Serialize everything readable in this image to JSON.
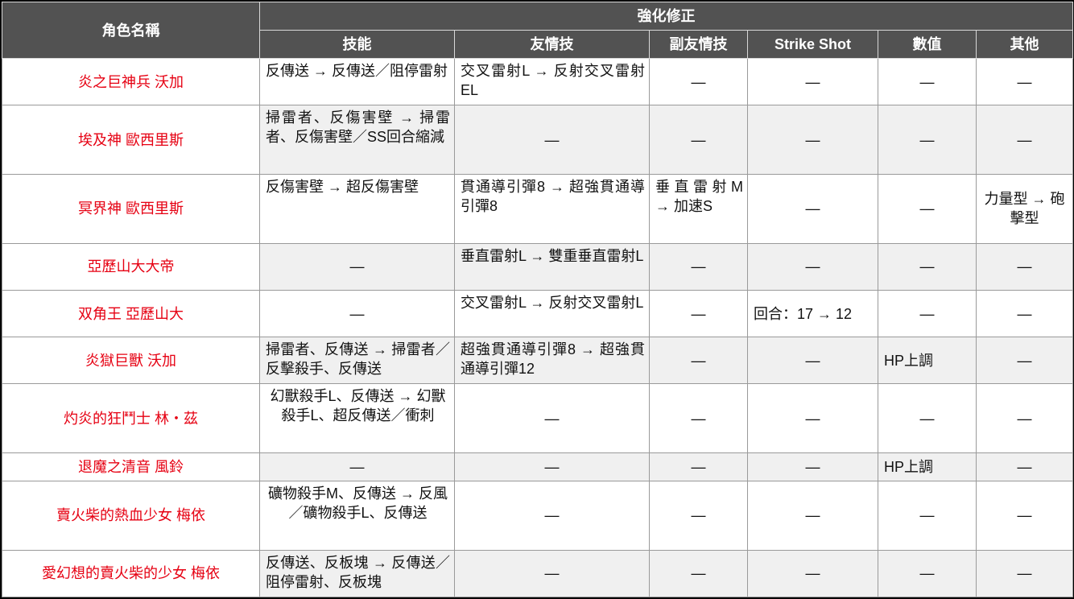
{
  "header": {
    "name_label": "角色名稱",
    "group_label": "強化修正",
    "columns": [
      "技能",
      "友情技",
      "副友情技",
      "Strike Shot",
      "數值",
      "其他"
    ]
  },
  "rows": [
    {
      "name": "炎之巨神兵 沃加",
      "skill": "反傳送 → 反傳送／阻停雷射",
      "friend": "交叉雷射L → 反射交叉雷射EL",
      "sub_friend": "—",
      "strike_shot": "—",
      "stats": "—",
      "other": "—"
    },
    {
      "name": "埃及神 歐西里斯",
      "skill": "掃雷者、反傷害壁 → 掃雷者、反傷害壁／SS回合縮減",
      "friend": "—",
      "sub_friend": "—",
      "strike_shot": "—",
      "stats": "—",
      "other": "—"
    },
    {
      "name": "冥界神 歐西里斯",
      "skill": "反傷害壁 → 超反傷害壁",
      "friend": "貫通導引彈8 → 超強貫通導引彈8",
      "sub_friend": "垂直雷射M → 加速S",
      "strike_shot": "—",
      "stats": "—",
      "other": "力量型 → 砲擊型"
    },
    {
      "name": "亞歷山大大帝",
      "skill": "—",
      "friend": "垂直雷射L → 雙重垂直雷射L",
      "sub_friend": "—",
      "strike_shot": "—",
      "stats": "—",
      "other": "—"
    },
    {
      "name": "双角王 亞歷山大",
      "skill": "—",
      "friend": "交叉雷射L → 反射交叉雷射L",
      "sub_friend": "—",
      "strike_shot": "回合：17 → 12",
      "stats": "—",
      "other": "—"
    },
    {
      "name": "炎獄巨獸 沃加",
      "skill": "掃雷者、反傳送 → 掃雷者／反擊殺手、反傳送",
      "friend": "超強貫通導引彈8 → 超強貫通導引彈12",
      "sub_friend": "—",
      "strike_shot": "—",
      "stats": "HP上調",
      "other": "—"
    },
    {
      "name": "灼炎的狂鬥士 林・茲",
      "skill": "幻獸殺手L、反傳送 → 幻獸殺手L、超反傳送／衝刺",
      "friend": "—",
      "sub_friend": "—",
      "strike_shot": "—",
      "stats": "—",
      "other": "—"
    },
    {
      "name": "退魔之清音 風鈴",
      "skill": "—",
      "friend": "—",
      "sub_friend": "—",
      "strike_shot": "—",
      "stats": "HP上調",
      "other": "—"
    },
    {
      "name": "賣火柴的熱血少女 梅依",
      "skill": "礦物殺手M、反傳送 → 反風／礦物殺手L、反傳送",
      "friend": "—",
      "sub_friend": "—",
      "strike_shot": "—",
      "stats": "—",
      "other": "—"
    },
    {
      "name": "愛幻想的賣火柴的少女 梅依",
      "skill": "反傳送、反板塊 → 反傳送／阻停雷射、反板塊",
      "friend": "—",
      "sub_friend": "—",
      "strike_shot": "—",
      "stats": "—",
      "other": "—"
    }
  ]
}
